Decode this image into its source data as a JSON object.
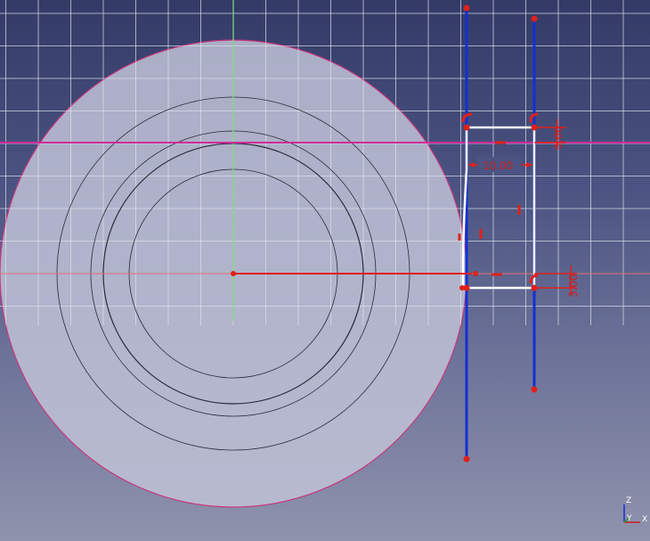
{
  "app": {
    "view": "sketch-editor-3d-view"
  },
  "colors": {
    "background_top": "#333a66",
    "background_bottom": "#8f93ad",
    "grid": "#b8bcd6",
    "disc_fill": "#c0c2d6",
    "disc_outline": "#c8377f",
    "construction_line": "#1230d4",
    "sketch_geometry": "#ffffff",
    "constraint": "#e0201a",
    "horizontal_axis": "#d02a9a",
    "vertical_axis": "#7de07d"
  },
  "dimensions": {
    "width_label": "10.00",
    "bottom_offset_label": "3.00",
    "top_offset_label": "3.00"
  },
  "axis_triad": {
    "z_label": "Z",
    "y_label": "Y",
    "x_label": "X"
  },
  "icons": [
    "horizontal-constraint-icon",
    "vertical-constraint-icon",
    "tangent-constraint-icon",
    "coincident-point-icon"
  ]
}
